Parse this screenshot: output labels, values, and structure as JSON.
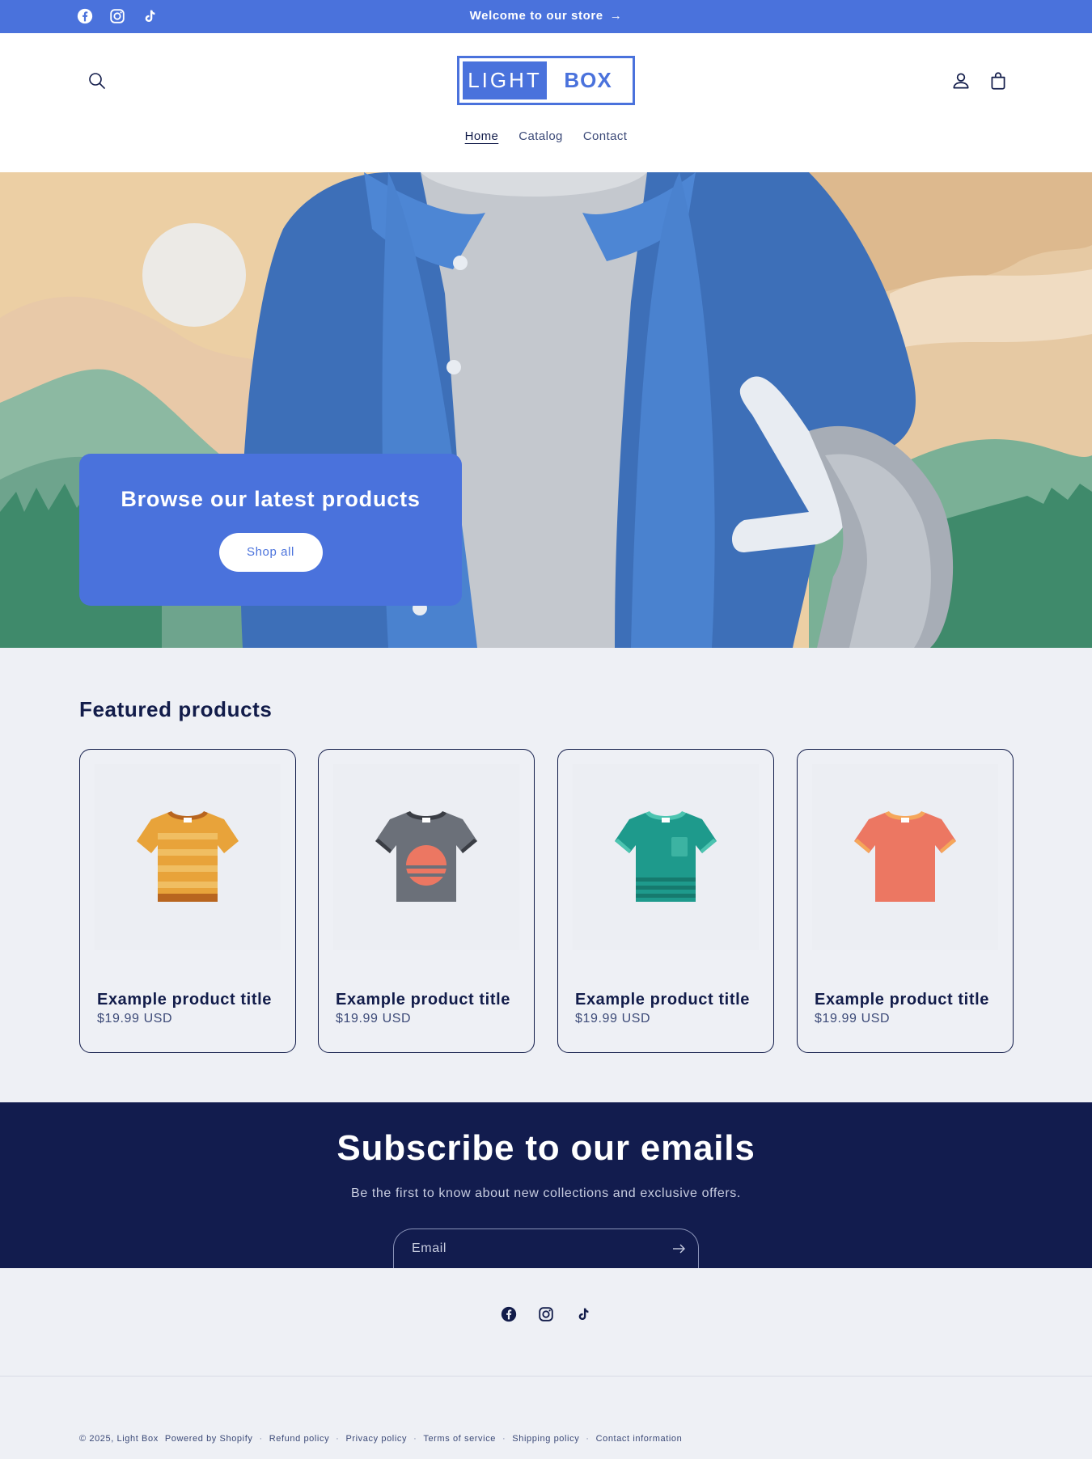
{
  "announcement": {
    "message": "Welcome to our store",
    "arrow": "→"
  },
  "header": {
    "logo": {
      "left": "LIGHT",
      "right": "BOX"
    },
    "nav": [
      {
        "label": "Home",
        "active": true
      },
      {
        "label": "Catalog",
        "active": false
      },
      {
        "label": "Contact",
        "active": false
      }
    ]
  },
  "hero": {
    "heading": "Browse our latest products",
    "button": "Shop all"
  },
  "featured": {
    "heading": "Featured products",
    "products": [
      {
        "title": "Example product title",
        "price": "$19.99 USD",
        "color": "#e8a33a"
      },
      {
        "title": "Example product title",
        "price": "$19.99 USD",
        "color": "#6b7079"
      },
      {
        "title": "Example product title",
        "price": "$19.99 USD",
        "color": "#1e9a8c"
      },
      {
        "title": "Example product title",
        "price": "$19.99 USD",
        "color": "#ec7762"
      }
    ]
  },
  "newsletter": {
    "heading": "Subscribe to our emails",
    "subtext": "Be the first to know about new collections and exclusive offers.",
    "email_placeholder": "Email"
  },
  "footer": {
    "copyright": "© 2025, Light Box",
    "powered": "Powered by Shopify",
    "policies": [
      "Refund policy",
      "Privacy policy",
      "Terms of service",
      "Shipping policy",
      "Contact information"
    ]
  },
  "colors": {
    "accent": "#4a72dc",
    "navy": "#121c4e",
    "background": "#eef0f5"
  },
  "icons": [
    "facebook-icon",
    "instagram-icon",
    "tiktok-icon",
    "search-icon",
    "account-icon",
    "cart-icon",
    "arrow-right-icon"
  ]
}
